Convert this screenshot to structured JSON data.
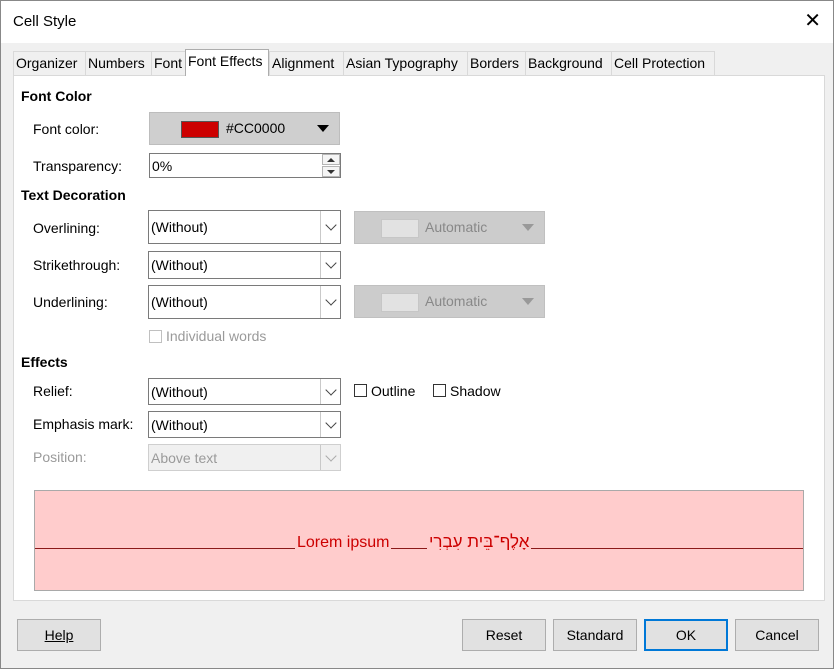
{
  "window": {
    "title": "Cell Style",
    "close_symbol": "✕"
  },
  "tabs": [
    {
      "label": "Organizer"
    },
    {
      "label": "Numbers"
    },
    {
      "label": "Font"
    },
    {
      "label": "Font Effects"
    },
    {
      "label": "Alignment"
    },
    {
      "label": "Asian Typography"
    },
    {
      "label": "Borders"
    },
    {
      "label": "Background"
    },
    {
      "label": "Cell Protection"
    }
  ],
  "active_tab": "Font Effects",
  "font_color": {
    "section": "Font Color",
    "color_label": "Font color:",
    "color_value": "#CC0000",
    "color_hex": "#cc0000",
    "transparency_label": "Transparency:",
    "transparency_value": "0%"
  },
  "text_decoration": {
    "section": "Text Decoration",
    "overlining_label": "Overlining:",
    "overlining_value": "(Without)",
    "overlining_color": "Automatic",
    "strikethrough_label": "Strikethrough:",
    "strikethrough_value": "(Without)",
    "underlining_label": "Underlining:",
    "underlining_value": "(Without)",
    "underlining_color": "Automatic",
    "individual_words": "Individual words"
  },
  "effects": {
    "section": "Effects",
    "relief_label": "Relief:",
    "relief_value": "(Without)",
    "outline_label": "Outline",
    "shadow_label": "Shadow",
    "emphasis_label": "Emphasis mark:",
    "emphasis_value": "(Without)",
    "position_label": "Position:",
    "position_value": "Above text"
  },
  "preview": {
    "latin_text": "Lorem ipsum",
    "rtl_text": "אָלֶף־בֵּית עִבְרִי",
    "background": "#ffcccc",
    "text_color": "#cc0000"
  },
  "buttons": {
    "help": "Help",
    "reset": "Reset",
    "standard": "Standard",
    "ok": "OK",
    "cancel": "Cancel"
  }
}
